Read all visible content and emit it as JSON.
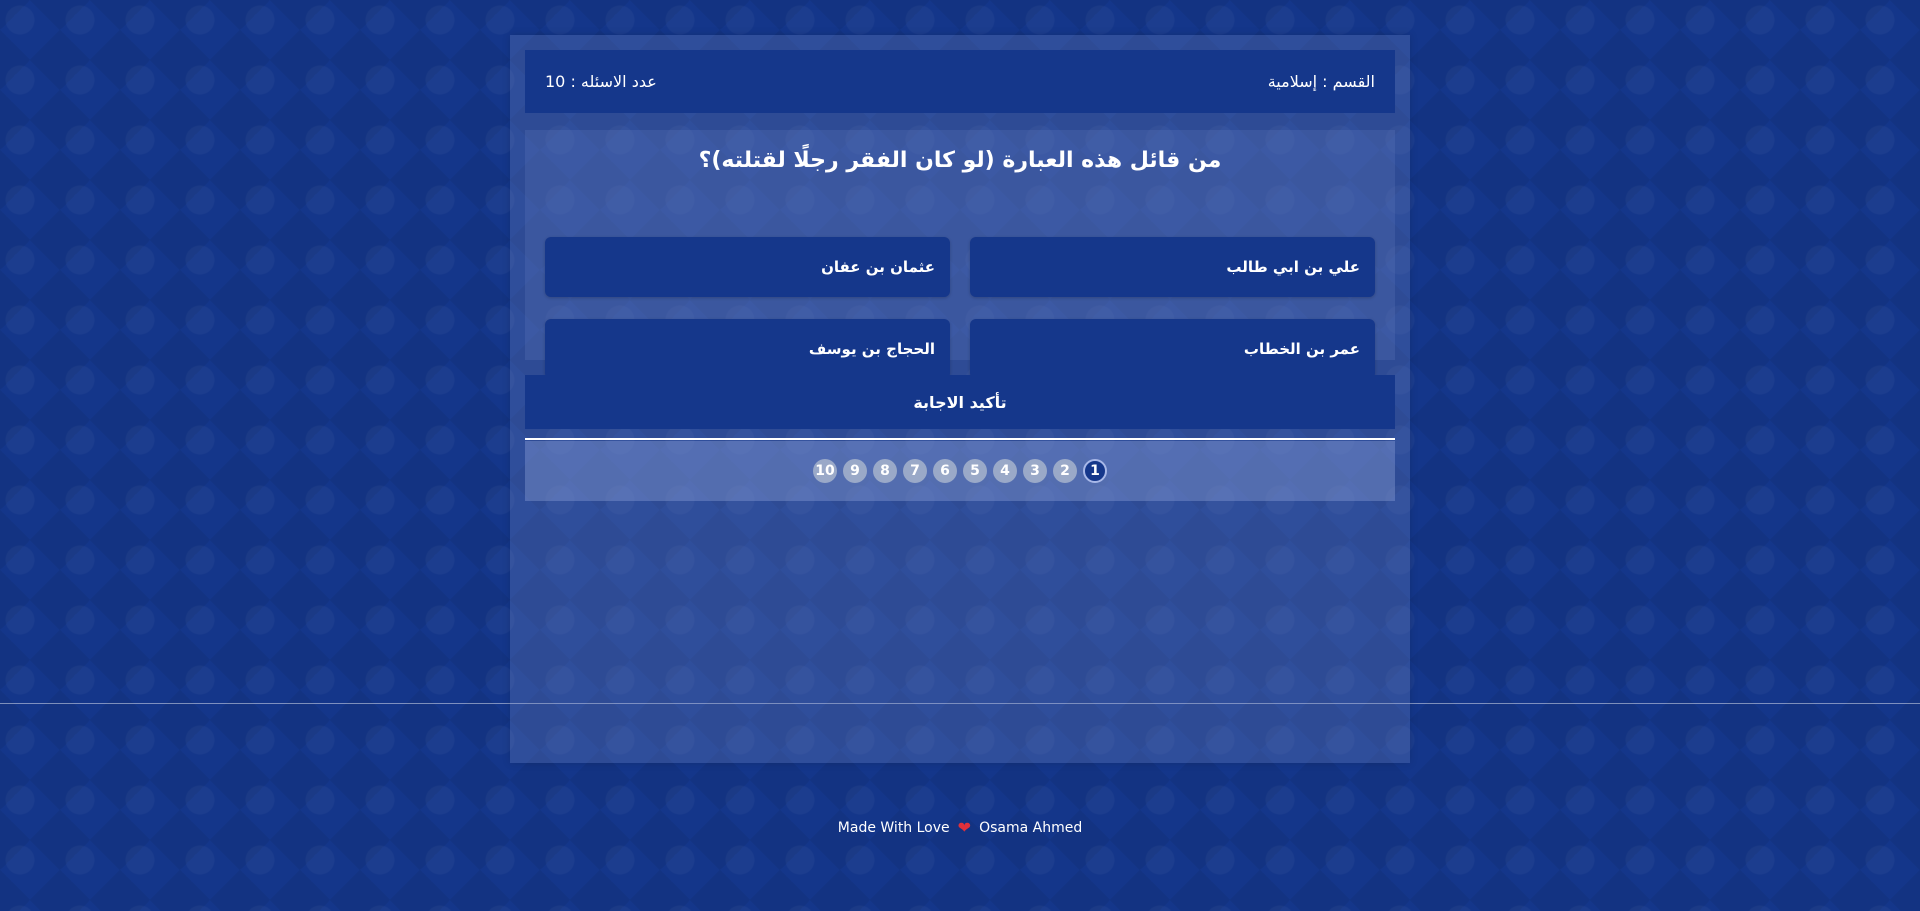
{
  "header": {
    "category": "القسم : إسلامية",
    "questions_count": "عدد الاسئله : 10"
  },
  "question": {
    "title": "من قائل هذه العبارة (لو كان الفقر رجلًا لقتلته)؟",
    "answers": [
      "علي بن ابي طالب",
      "عثمان بن عفان",
      "عمر بن الخطاب",
      "الحجاج بن يوسف"
    ]
  },
  "submit_label": "تأكيد الاجابة",
  "bullets": {
    "items": [
      "1",
      "2",
      "3",
      "4",
      "5",
      "6",
      "7",
      "8",
      "9",
      "10"
    ],
    "active": 1
  },
  "footer": {
    "text_before": "Made With Love",
    "icon": "heart-icon",
    "author": "Osama Ahmed"
  },
  "colors": {
    "background": "#14368a",
    "panel": "#15378b",
    "heart": "#e0303a"
  }
}
